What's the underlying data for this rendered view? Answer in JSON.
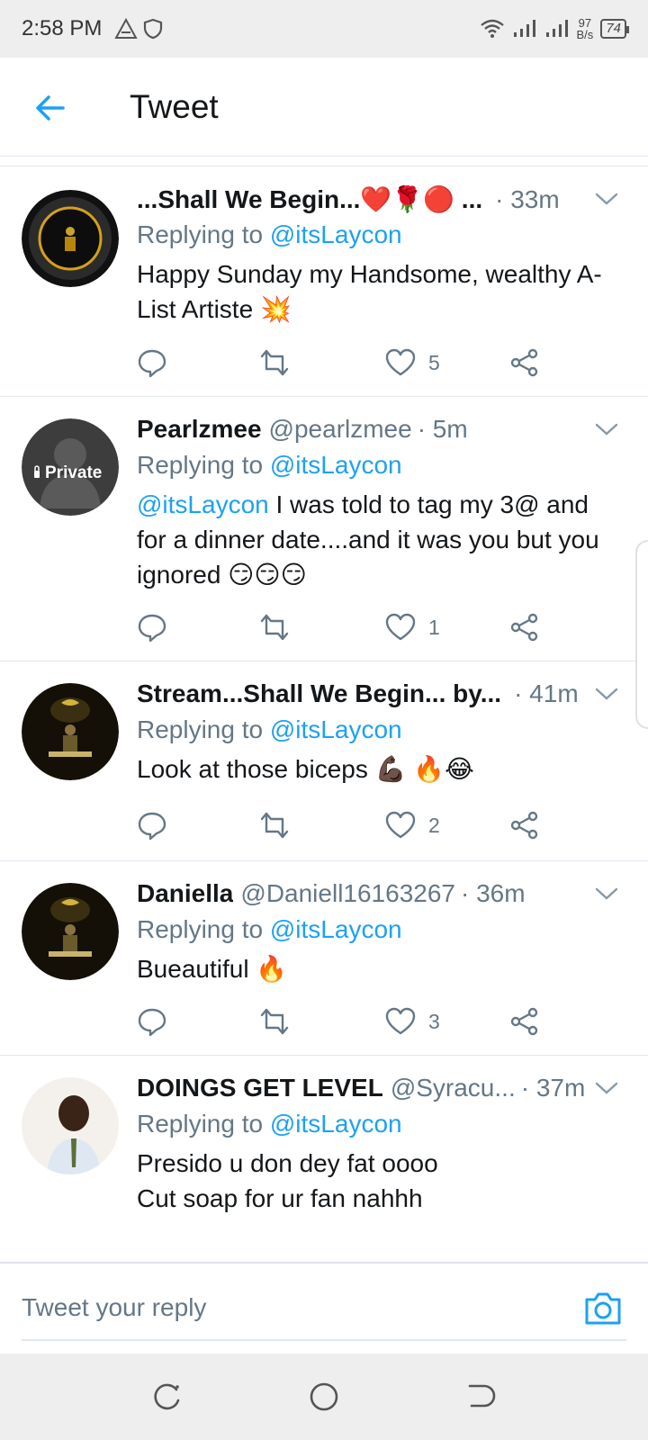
{
  "status_bar": {
    "time": "2:58 PM",
    "speed": "97",
    "speed_unit": "B/s",
    "battery": "74"
  },
  "header": {
    "title": "Tweet"
  },
  "tweets": [
    {
      "name": "...Shall We Begin...❤️🌹🔴 ...",
      "handle": "",
      "time": "· 33m",
      "replying_prefix": "Replying to",
      "replying_to": "@itsLaycon",
      "text": "Happy Sunday my Handsome, wealthy A-List Artiste 💥",
      "likes": "5"
    },
    {
      "name": "Pearlzmee",
      "handle": "@pearlzmee",
      "time": "· 5m",
      "replying_prefix": "Replying to",
      "replying_to": "@itsLaycon",
      "mention_lead": "@itsLaycon",
      "text": " I was told to tag my 3@ and for a dinner date....and it was you but you ignored 😏😏😏",
      "likes": "1",
      "avatar_label": "Private"
    },
    {
      "name": "Stream...Shall We Begin... by...",
      "handle": "",
      "time": "· 41m",
      "replying_prefix": "Replying to",
      "replying_to": "@itsLaycon",
      "text": "Look at those biceps 💪🏿 🔥😂",
      "likes": "2"
    },
    {
      "name": "Daniella",
      "handle": "@Daniell16163267",
      "time": "· 36m",
      "replying_prefix": "Replying to",
      "replying_to": "@itsLaycon",
      "text": "Bueautiful 🔥",
      "likes": "3"
    },
    {
      "name": "DOINGS GET LEVEL",
      "handle": "@Syracu...",
      "time": "· 37m",
      "replying_prefix": "Replying to",
      "replying_to": "@itsLaycon",
      "text": "Presido u don dey fat oooo\nCut soap for ur fan nahhh",
      "likes": ""
    }
  ],
  "reply": {
    "placeholder": "Tweet your reply"
  },
  "colors": {
    "accent": "#1da1f2",
    "muted": "#657786",
    "text": "#14171a"
  }
}
